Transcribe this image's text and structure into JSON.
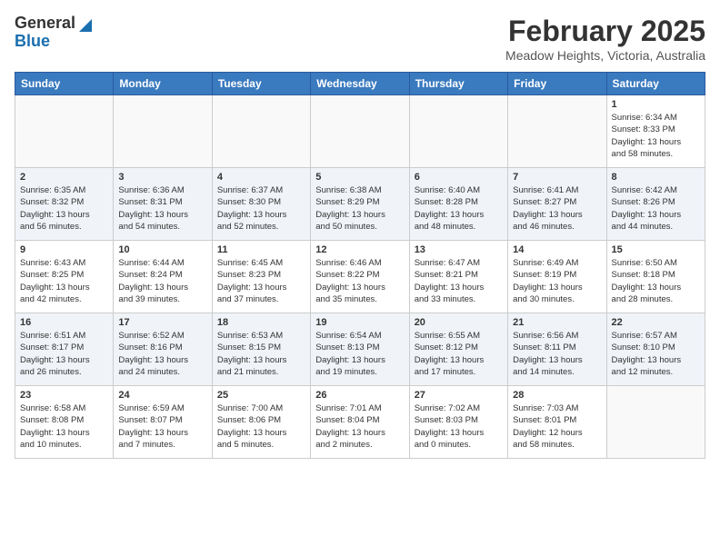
{
  "header": {
    "logo_line1": "General",
    "logo_line2": "Blue",
    "month": "February 2025",
    "location": "Meadow Heights, Victoria, Australia"
  },
  "weekdays": [
    "Sunday",
    "Monday",
    "Tuesday",
    "Wednesday",
    "Thursday",
    "Friday",
    "Saturday"
  ],
  "weeks": [
    [
      {
        "day": "",
        "info": ""
      },
      {
        "day": "",
        "info": ""
      },
      {
        "day": "",
        "info": ""
      },
      {
        "day": "",
        "info": ""
      },
      {
        "day": "",
        "info": ""
      },
      {
        "day": "",
        "info": ""
      },
      {
        "day": "1",
        "info": "Sunrise: 6:34 AM\nSunset: 8:33 PM\nDaylight: 13 hours\nand 58 minutes."
      }
    ],
    [
      {
        "day": "2",
        "info": "Sunrise: 6:35 AM\nSunset: 8:32 PM\nDaylight: 13 hours\nand 56 minutes."
      },
      {
        "day": "3",
        "info": "Sunrise: 6:36 AM\nSunset: 8:31 PM\nDaylight: 13 hours\nand 54 minutes."
      },
      {
        "day": "4",
        "info": "Sunrise: 6:37 AM\nSunset: 8:30 PM\nDaylight: 13 hours\nand 52 minutes."
      },
      {
        "day": "5",
        "info": "Sunrise: 6:38 AM\nSunset: 8:29 PM\nDaylight: 13 hours\nand 50 minutes."
      },
      {
        "day": "6",
        "info": "Sunrise: 6:40 AM\nSunset: 8:28 PM\nDaylight: 13 hours\nand 48 minutes."
      },
      {
        "day": "7",
        "info": "Sunrise: 6:41 AM\nSunset: 8:27 PM\nDaylight: 13 hours\nand 46 minutes."
      },
      {
        "day": "8",
        "info": "Sunrise: 6:42 AM\nSunset: 8:26 PM\nDaylight: 13 hours\nand 44 minutes."
      }
    ],
    [
      {
        "day": "9",
        "info": "Sunrise: 6:43 AM\nSunset: 8:25 PM\nDaylight: 13 hours\nand 42 minutes."
      },
      {
        "day": "10",
        "info": "Sunrise: 6:44 AM\nSunset: 8:24 PM\nDaylight: 13 hours\nand 39 minutes."
      },
      {
        "day": "11",
        "info": "Sunrise: 6:45 AM\nSunset: 8:23 PM\nDaylight: 13 hours\nand 37 minutes."
      },
      {
        "day": "12",
        "info": "Sunrise: 6:46 AM\nSunset: 8:22 PM\nDaylight: 13 hours\nand 35 minutes."
      },
      {
        "day": "13",
        "info": "Sunrise: 6:47 AM\nSunset: 8:21 PM\nDaylight: 13 hours\nand 33 minutes."
      },
      {
        "day": "14",
        "info": "Sunrise: 6:49 AM\nSunset: 8:19 PM\nDaylight: 13 hours\nand 30 minutes."
      },
      {
        "day": "15",
        "info": "Sunrise: 6:50 AM\nSunset: 8:18 PM\nDaylight: 13 hours\nand 28 minutes."
      }
    ],
    [
      {
        "day": "16",
        "info": "Sunrise: 6:51 AM\nSunset: 8:17 PM\nDaylight: 13 hours\nand 26 minutes."
      },
      {
        "day": "17",
        "info": "Sunrise: 6:52 AM\nSunset: 8:16 PM\nDaylight: 13 hours\nand 24 minutes."
      },
      {
        "day": "18",
        "info": "Sunrise: 6:53 AM\nSunset: 8:15 PM\nDaylight: 13 hours\nand 21 minutes."
      },
      {
        "day": "19",
        "info": "Sunrise: 6:54 AM\nSunset: 8:13 PM\nDaylight: 13 hours\nand 19 minutes."
      },
      {
        "day": "20",
        "info": "Sunrise: 6:55 AM\nSunset: 8:12 PM\nDaylight: 13 hours\nand 17 minutes."
      },
      {
        "day": "21",
        "info": "Sunrise: 6:56 AM\nSunset: 8:11 PM\nDaylight: 13 hours\nand 14 minutes."
      },
      {
        "day": "22",
        "info": "Sunrise: 6:57 AM\nSunset: 8:10 PM\nDaylight: 13 hours\nand 12 minutes."
      }
    ],
    [
      {
        "day": "23",
        "info": "Sunrise: 6:58 AM\nSunset: 8:08 PM\nDaylight: 13 hours\nand 10 minutes."
      },
      {
        "day": "24",
        "info": "Sunrise: 6:59 AM\nSunset: 8:07 PM\nDaylight: 13 hours\nand 7 minutes."
      },
      {
        "day": "25",
        "info": "Sunrise: 7:00 AM\nSunset: 8:06 PM\nDaylight: 13 hours\nand 5 minutes."
      },
      {
        "day": "26",
        "info": "Sunrise: 7:01 AM\nSunset: 8:04 PM\nDaylight: 13 hours\nand 2 minutes."
      },
      {
        "day": "27",
        "info": "Sunrise: 7:02 AM\nSunset: 8:03 PM\nDaylight: 13 hours\nand 0 minutes."
      },
      {
        "day": "28",
        "info": "Sunrise: 7:03 AM\nSunset: 8:01 PM\nDaylight: 12 hours\nand 58 minutes."
      },
      {
        "day": "",
        "info": ""
      }
    ]
  ]
}
